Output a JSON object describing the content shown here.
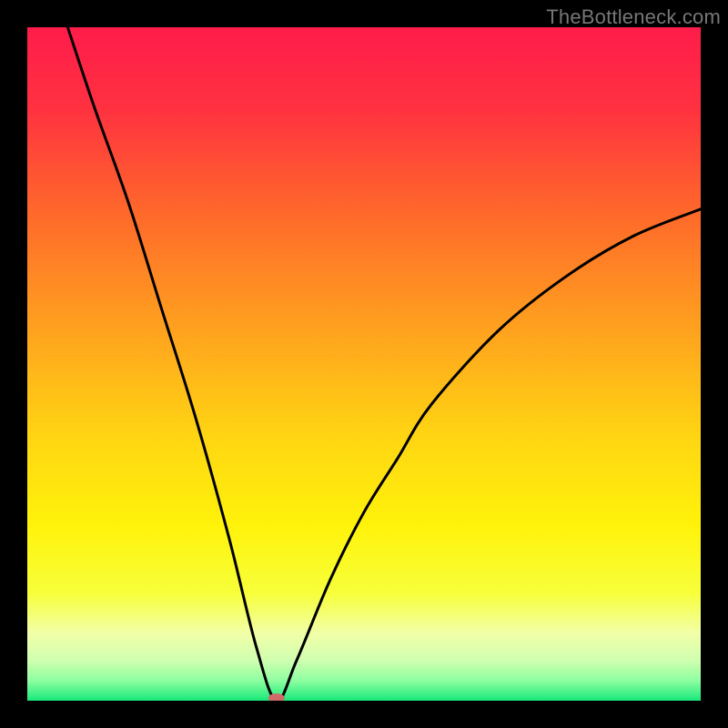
{
  "watermark": "TheBottleneck.com",
  "chart_data": {
    "type": "line",
    "title": "",
    "xlabel": "",
    "ylabel": "",
    "xlim": [
      0,
      100
    ],
    "ylim": [
      0,
      100
    ],
    "note": "Abstract V-shaped curve over a vertical spectral gradient. No numeric axes, ticks, or labels are visible.",
    "gradient_stops": [
      {
        "offset": 0.0,
        "color": "#ff1c4b"
      },
      {
        "offset": 0.12,
        "color": "#ff3140"
      },
      {
        "offset": 0.28,
        "color": "#ff6a2a"
      },
      {
        "offset": 0.45,
        "color": "#ffa21e"
      },
      {
        "offset": 0.6,
        "color": "#ffd313"
      },
      {
        "offset": 0.74,
        "color": "#fff30a"
      },
      {
        "offset": 0.84,
        "color": "#f7ff3a"
      },
      {
        "offset": 0.9,
        "color": "#f2ffa8"
      },
      {
        "offset": 0.94,
        "color": "#d0ffb0"
      },
      {
        "offset": 0.97,
        "color": "#8effa0"
      },
      {
        "offset": 1.0,
        "color": "#18e87a"
      }
    ],
    "curve_minimum_x": 37,
    "curve_left_start": {
      "x": 6,
      "y": 100
    },
    "curve_right_end": {
      "x": 100,
      "y": 73
    },
    "series": [
      {
        "name": "curve",
        "points": [
          {
            "x": 6,
            "y": 100
          },
          {
            "x": 10,
            "y": 88
          },
          {
            "x": 15,
            "y": 74
          },
          {
            "x": 20,
            "y": 58
          },
          {
            "x": 25,
            "y": 42
          },
          {
            "x": 30,
            "y": 24
          },
          {
            "x": 34,
            "y": 8
          },
          {
            "x": 37,
            "y": 0
          },
          {
            "x": 40,
            "y": 6
          },
          {
            "x": 45,
            "y": 18
          },
          {
            "x": 50,
            "y": 28
          },
          {
            "x": 55,
            "y": 36
          },
          {
            "x": 60,
            "y": 44
          },
          {
            "x": 70,
            "y": 55
          },
          {
            "x": 80,
            "y": 63
          },
          {
            "x": 90,
            "y": 69
          },
          {
            "x": 100,
            "y": 73
          }
        ]
      }
    ],
    "marker": {
      "x": 37,
      "y": 0,
      "color": "#d06a6a",
      "rx": 9,
      "ry": 5
    }
  }
}
